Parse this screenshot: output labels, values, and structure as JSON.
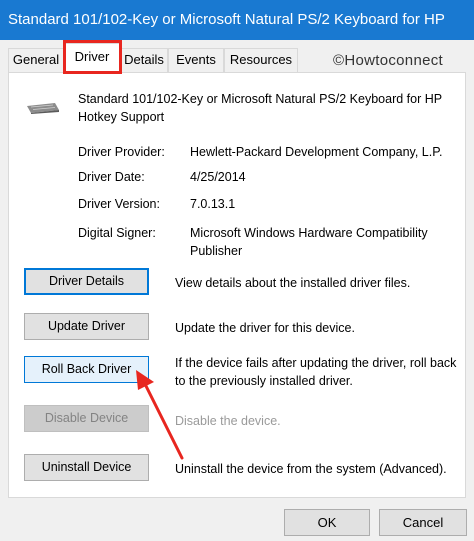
{
  "window": {
    "title": "Standard 101/102-Key or Microsoft Natural PS/2 Keyboard for HP"
  },
  "tabs": [
    {
      "label": "General"
    },
    {
      "label": "Driver"
    },
    {
      "label": "Details"
    },
    {
      "label": "Events"
    },
    {
      "label": "Resources"
    }
  ],
  "watermark": "©Howtoconnect",
  "device": {
    "name": "Standard 101/102-Key or Microsoft Natural PS/2 Keyboard for HP Hotkey Support",
    "icon": "keyboard-icon"
  },
  "info": {
    "provider_label": "Driver Provider:",
    "provider_value": "Hewlett-Packard Development Company, L.P.",
    "date_label": "Driver Date:",
    "date_value": "4/25/2014",
    "version_label": "Driver Version:",
    "version_value": "7.0.13.1",
    "signer_label": "Digital Signer:",
    "signer_value": "Microsoft Windows Hardware Compatibility Publisher"
  },
  "actions": {
    "details_label": "Driver Details",
    "details_desc": "View details about the installed driver files.",
    "update_label": "Update Driver",
    "update_desc": "Update the driver for this device.",
    "rollback_label": "Roll Back Driver",
    "rollback_desc": "If the device fails after updating the driver, roll back to the previously installed driver.",
    "disable_label": "Disable Device",
    "disable_desc": "Disable the device.",
    "uninstall_label": "Uninstall Device",
    "uninstall_desc": "Uninstall the device from the system (Advanced)."
  },
  "footer": {
    "ok_label": "OK",
    "cancel_label": "Cancel"
  },
  "colors": {
    "titlebar": "#1979d1",
    "highlight": "#e8261f",
    "focus": "#0078d7"
  }
}
